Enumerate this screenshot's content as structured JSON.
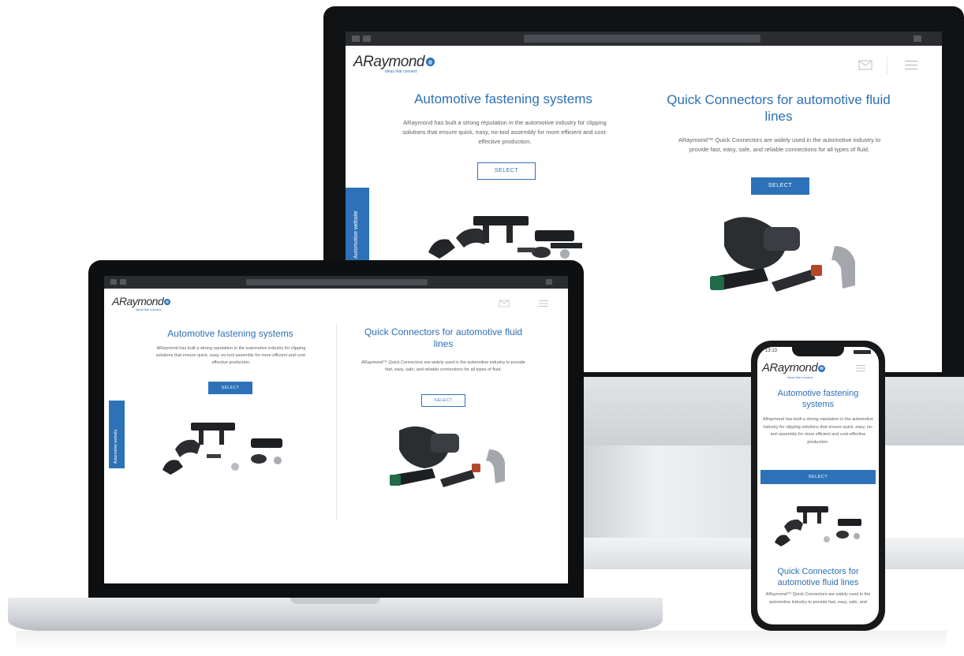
{
  "brand": {
    "name": "ARaymond",
    "tagline": "ideas that connect"
  },
  "status_bar": {
    "time": "13:13"
  },
  "sections": {
    "fastening": {
      "title": "Automotive fastening systems",
      "description": "ARaymond has built a strong reputation in the automotive industry for clipping solutions that ensure quick, easy, no-tool assembly for more efficient and cost-effective production.",
      "button": "SELECT"
    },
    "connectors": {
      "title": "Quick Connectors for automotive fluid lines",
      "description": "ARaymond™ Quick Connectors are widely used in the automotive industry to provide fast, easy, safe, and reliable connections for all types of fluid.",
      "button": "SELECT"
    }
  },
  "side_tab": {
    "label": "Automotive website"
  },
  "icons": {
    "mail": "mail-icon",
    "menu": "hamburger-menu-icon"
  },
  "colors": {
    "accent": "#2d72b8",
    "title": "#2d6fb5"
  }
}
